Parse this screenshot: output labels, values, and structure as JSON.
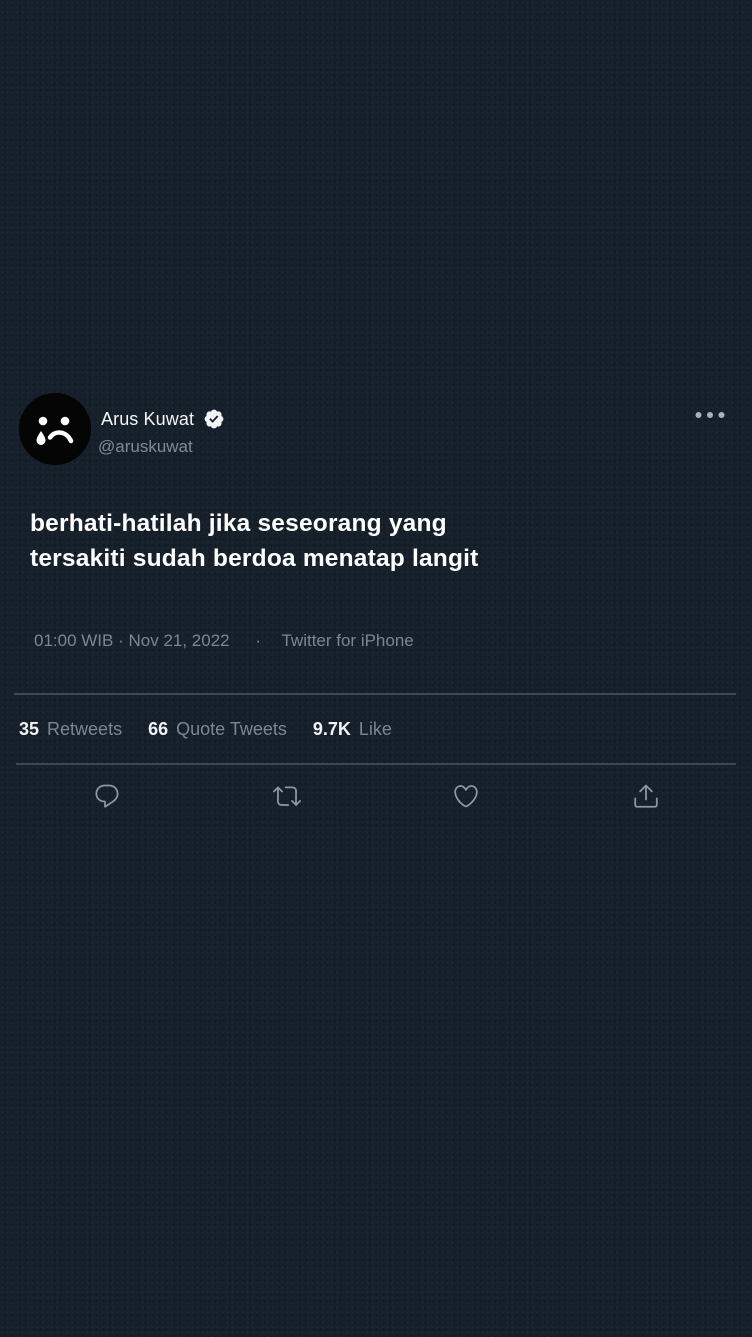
{
  "tweet": {
    "author": {
      "display_name": "Arus Kuwat",
      "handle": "@aruskuwat",
      "verified": true,
      "avatar_icon": "sad-face-icon"
    },
    "text_lines": [
      "berhati-hatilah jika seseorang yang",
      "tersakiti sudah berdoa menatap langit"
    ],
    "time": "01:00 WIB",
    "date": "Nov 21, 2022",
    "source": "Twitter for iPhone",
    "stats": {
      "retweets_count": "35",
      "retweets_label": "Retweets",
      "quotes_count": "66",
      "quotes_label": "Quote Tweets",
      "likes_count": "9.7K",
      "likes_label": "Like"
    },
    "actions": [
      "reply-icon",
      "retweet-icon",
      "like-icon",
      "share-icon"
    ]
  },
  "colors": {
    "background": "#16202b",
    "primary_text": "#ffffff",
    "secondary_text": "#7a8793",
    "divider": "#3b4856",
    "icon": "#8899a6"
  }
}
